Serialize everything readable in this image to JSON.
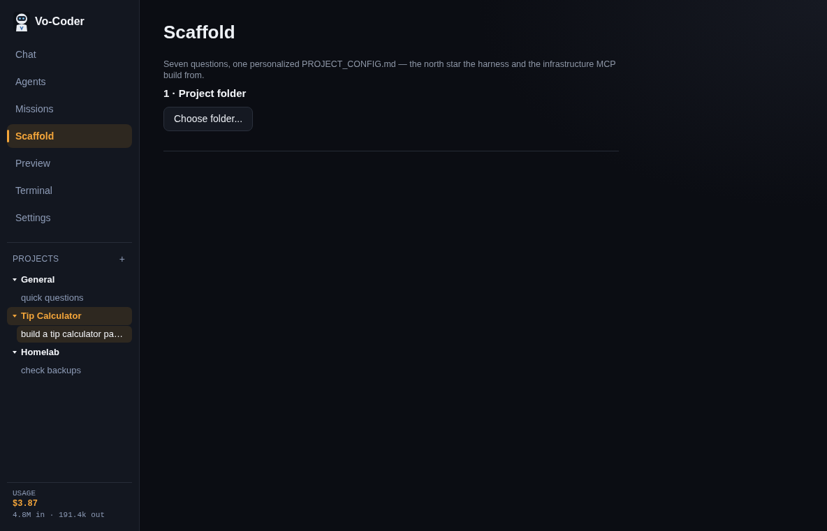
{
  "app": {
    "name": "Vo-Coder"
  },
  "nav": [
    {
      "label": "Chat",
      "selected": false
    },
    {
      "label": "Agents",
      "selected": false
    },
    {
      "label": "Missions",
      "selected": false
    },
    {
      "label": "Scaffold",
      "selected": true
    },
    {
      "label": "Preview",
      "selected": false
    },
    {
      "label": "Terminal",
      "selected": false
    },
    {
      "label": "Settings",
      "selected": false
    }
  ],
  "projects": {
    "title": "PROJECTS",
    "add_label": "+",
    "items": [
      {
        "name": "General",
        "expanded": true,
        "selected": false,
        "children": [
          {
            "name": "quick questions",
            "selected": false
          }
        ]
      },
      {
        "name": "Tip Calculator",
        "expanded": true,
        "selected": true,
        "children": [
          {
            "name": "build a tip calculator pa…",
            "selected": true
          }
        ]
      },
      {
        "name": "Homelab",
        "expanded": true,
        "selected": false,
        "children": [
          {
            "name": "check backups",
            "selected": false
          }
        ]
      }
    ]
  },
  "usage": {
    "title": "USAGE",
    "cost": "$3.87",
    "tokens": "4.8M in · 191.4k out"
  },
  "page": {
    "title": "Scaffold",
    "description": "Seven questions, one personalized PROJECT_CONFIG.md — the north star the harness and the infrastructure MCP build from.",
    "step": {
      "title": "1 · Project folder",
      "button": "Choose folder..."
    }
  }
}
